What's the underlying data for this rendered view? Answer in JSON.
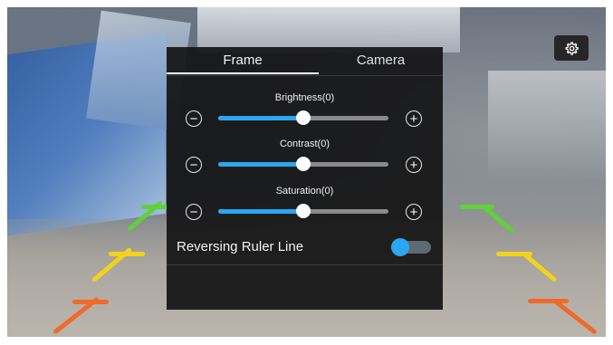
{
  "tabs": [
    {
      "label": "Frame",
      "active": true
    },
    {
      "label": "Camera",
      "active": false
    }
  ],
  "sliders": [
    {
      "label": "Brightness(0)",
      "value": 0,
      "fraction": 0.5
    },
    {
      "label": "Contrast(0)",
      "value": 0,
      "fraction": 0.5
    },
    {
      "label": "Saturation(0)",
      "value": 0,
      "fraction": 0.5
    }
  ],
  "buttons": {
    "decrease_symbol": "−",
    "increase_symbol": "+"
  },
  "toggle": {
    "label": "Reversing Ruler Line",
    "on": true
  },
  "icons": {
    "settings": "gear-icon"
  },
  "colors": {
    "accent": "#29a8f0",
    "panel": "#141416",
    "guide_green": "#5fd23a",
    "guide_yellow": "#f2d21c",
    "guide_red": "#f06a2a"
  }
}
